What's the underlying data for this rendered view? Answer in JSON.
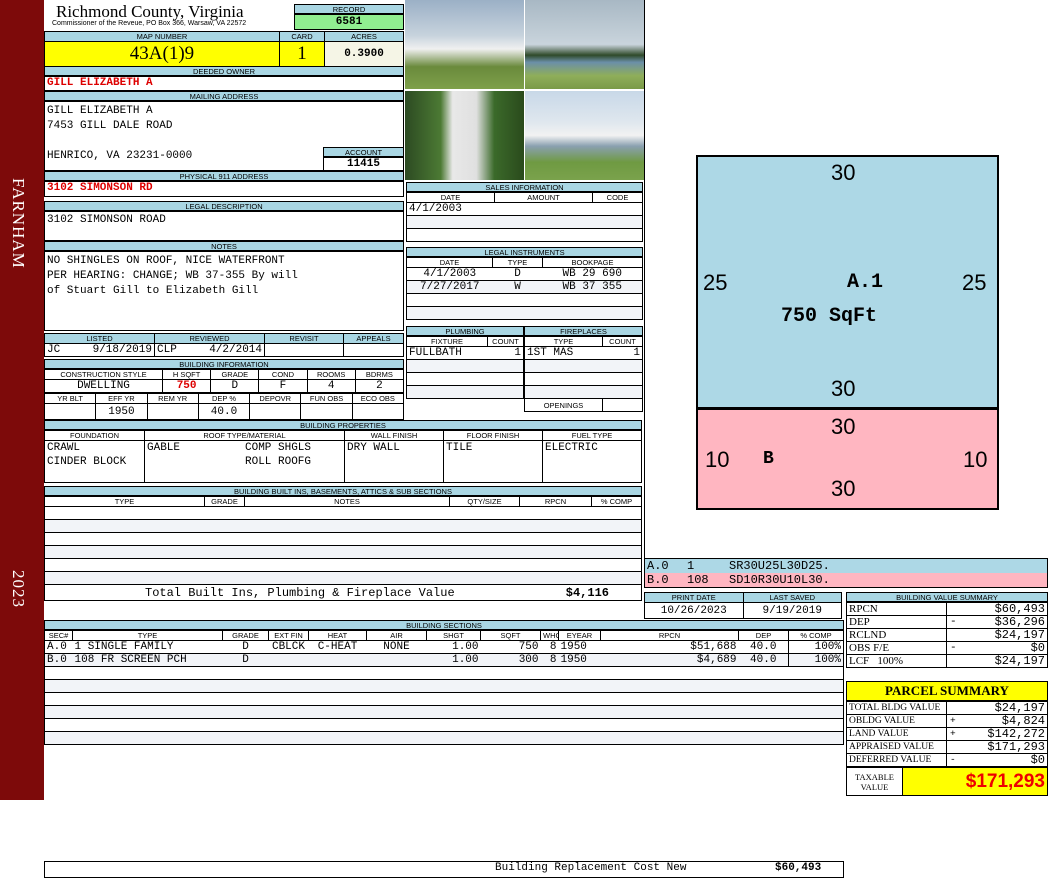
{
  "sidebar": {
    "district": "FARNHAM",
    "year": "2023"
  },
  "header": {
    "county": "Richmond County, Virginia",
    "office": "Commissioner of the Reveue, PO Box 366, Warsaw, VA 22572",
    "record_label": "RECORD",
    "record": "6581"
  },
  "parcel": {
    "map_label": "MAP NUMBER",
    "map": "43A(1)9",
    "card_label": "CARD",
    "card": "1",
    "acres_label": "ACRES",
    "acres": "0.3900"
  },
  "owner": {
    "label": "DEEDED OWNER",
    "name": "GILL ELIZABETH A"
  },
  "mailing": {
    "label": "MAILING ADDRESS",
    "line1": "GILL ELIZABETH A",
    "line2": "7453 GILL DALE ROAD",
    "line3": "HENRICO, VA 23231-0000",
    "account_label": "ACCOUNT",
    "account": "11415"
  },
  "physical": {
    "label": "PHYSICAL 911 ADDRESS",
    "value": "3102 SIMONSON RD"
  },
  "legal": {
    "label": "LEGAL DESCRIPTION",
    "value": "3102 SIMONSON ROAD"
  },
  "notes": {
    "label": "NOTES",
    "lines": [
      "NO SHINGLES ON ROOF, NICE WATERFRONT",
      "PER HEARING: CHANGE; WB 37-355 By will",
      "of Stuart Gill to Elizabeth Gill"
    ]
  },
  "review": {
    "headers": [
      "LISTED",
      "REVIEWED",
      "REVISIT",
      "APPEALS"
    ],
    "listed_by": "JC",
    "listed_date": "9/18/2019",
    "reviewed_by": "CLP",
    "reviewed_date": "4/2/2014"
  },
  "building_info": {
    "label": "BUILDING INFORMATION",
    "headers1": [
      "CONSTRUCTION STYLE",
      "H SQFT",
      "GRADE",
      "COND",
      "ROOMS",
      "BDRMS"
    ],
    "style": "DWELLING",
    "hsqft": "750",
    "grade": "D",
    "cond": "F",
    "rooms": "4",
    "bdrms": "2",
    "headers2": [
      "YR BLT",
      "EFF YR",
      "REM YR",
      "DEP %",
      "DEPOVR",
      "FUN OBS",
      "ECO OBS"
    ],
    "eff_yr": "1950",
    "dep": "40.0"
  },
  "sales": {
    "label": "SALES INFORMATION",
    "headers": [
      "DATE",
      "AMOUNT",
      "CODE"
    ],
    "rows": [
      [
        "4/1/2003",
        "",
        ""
      ]
    ]
  },
  "instruments": {
    "label": "LEGAL INSTRUMENTS",
    "headers": [
      "DATE",
      "TYPE",
      "BOOKPAGE"
    ],
    "rows": [
      [
        "4/1/2003",
        "D",
        "WB 29 690"
      ],
      [
        "7/27/2017",
        "W",
        "WB 37 355"
      ]
    ]
  },
  "plumbing": {
    "label": "PLUMBING",
    "headers": [
      "FIXTURE",
      "COUNT"
    ],
    "fixture": "FULLBATH",
    "count": "1"
  },
  "fireplaces": {
    "label": "FIREPLACES",
    "headers": [
      "TYPE",
      "COUNT"
    ],
    "type": "1ST MAS",
    "count": "1",
    "openings": "OPENINGS"
  },
  "properties": {
    "label": "BUILDING PROPERTIES",
    "headers": [
      "FOUNDATION",
      "ROOF TYPE/MATERIAL",
      "WALL FINISH",
      "FLOOR FINISH",
      "FUEL TYPE"
    ],
    "foundation": [
      "CRAWL",
      "CINDER BLOCK"
    ],
    "roof_type": "GABLE",
    "roof_material": [
      "COMP SHGLS",
      "ROLL ROOFG"
    ],
    "wall": "DRY WALL",
    "floor": "TILE",
    "fuel": "ELECTRIC"
  },
  "builtins": {
    "label": "BUILDING BUILT INS, BASEMENTS, ATTICS & SUB SECTIONS",
    "headers": [
      "TYPE",
      "GRADE",
      "NOTES",
      "QTY/SIZE",
      "RPCN",
      "% COMP"
    ],
    "total_label": "Total Built Ins, Plumbing & Fireplace Value",
    "total": "$4,116"
  },
  "dates": {
    "print_label": "PRINT DATE",
    "print": "10/26/2023",
    "saved_label": "LAST SAVED",
    "saved": "9/19/2019"
  },
  "sections": {
    "label": "BUILDING SECTIONS",
    "headers": [
      "SEC#",
      "TYPE",
      "GRADE",
      "EXT FIN",
      "HEAT",
      "AIR",
      "SHGT",
      "SQFT",
      "WHGT",
      "EYEAR",
      "RPCN",
      "DEP",
      "% COMP"
    ],
    "rows": [
      [
        "A.0",
        "1 SINGLE FAMILY",
        "D",
        "CBLCK",
        "C-HEAT",
        "NONE",
        "1.00",
        "750",
        "8",
        "1950",
        "$51,688",
        "40.0",
        "100%"
      ],
      [
        "B.0",
        "108 FR SCREEN PCH",
        "D",
        "",
        "",
        "",
        "1.00",
        "300",
        "8",
        "1950",
        "$4,689",
        "40.0",
        "100%"
      ]
    ],
    "total_label": "Building Replacement Cost New",
    "total": "$60,493"
  },
  "sketch": {
    "a_label": "A.1",
    "a_area": "750 SqFt",
    "a_top": "30",
    "a_bottom": "30",
    "a_left": "25",
    "a_right": "25",
    "b_label": "B",
    "b_top": "30",
    "b_bottom": "30",
    "b_left": "10",
    "b_right": "10",
    "vectors": [
      [
        "A.0",
        "1",
        "SR30U25L30D25."
      ],
      [
        "B.0",
        "108",
        "SD10R30U10L30."
      ]
    ],
    "a_color": "#add8e6",
    "b_color": "#ffb6c1"
  },
  "value_summary": {
    "label": "BUILDING VALUE SUMMARY",
    "rows": [
      [
        "RPCN",
        "",
        "$60,493"
      ],
      [
        "DEP",
        "-",
        "$36,296"
      ],
      [
        "RCLND",
        "",
        "$24,197"
      ],
      [
        "OBS F/E",
        "-",
        "$0"
      ],
      [
        "LCF   100%",
        "",
        "$24,197"
      ]
    ]
  },
  "parcel_summary": {
    "label": "PARCEL SUMMARY",
    "rows": [
      [
        "TOTAL BLDG VALUE",
        "",
        "$24,197"
      ],
      [
        "OBLDG VALUE",
        "+",
        "$4,824"
      ],
      [
        "LAND VALUE",
        "+",
        "$142,272"
      ],
      [
        "APPRAISED VALUE",
        "",
        "$171,293"
      ],
      [
        "DEFERRED VALUE",
        "-",
        "$0"
      ]
    ],
    "taxable_label": "TAXABLE VALUE",
    "taxable": "$171,293"
  }
}
